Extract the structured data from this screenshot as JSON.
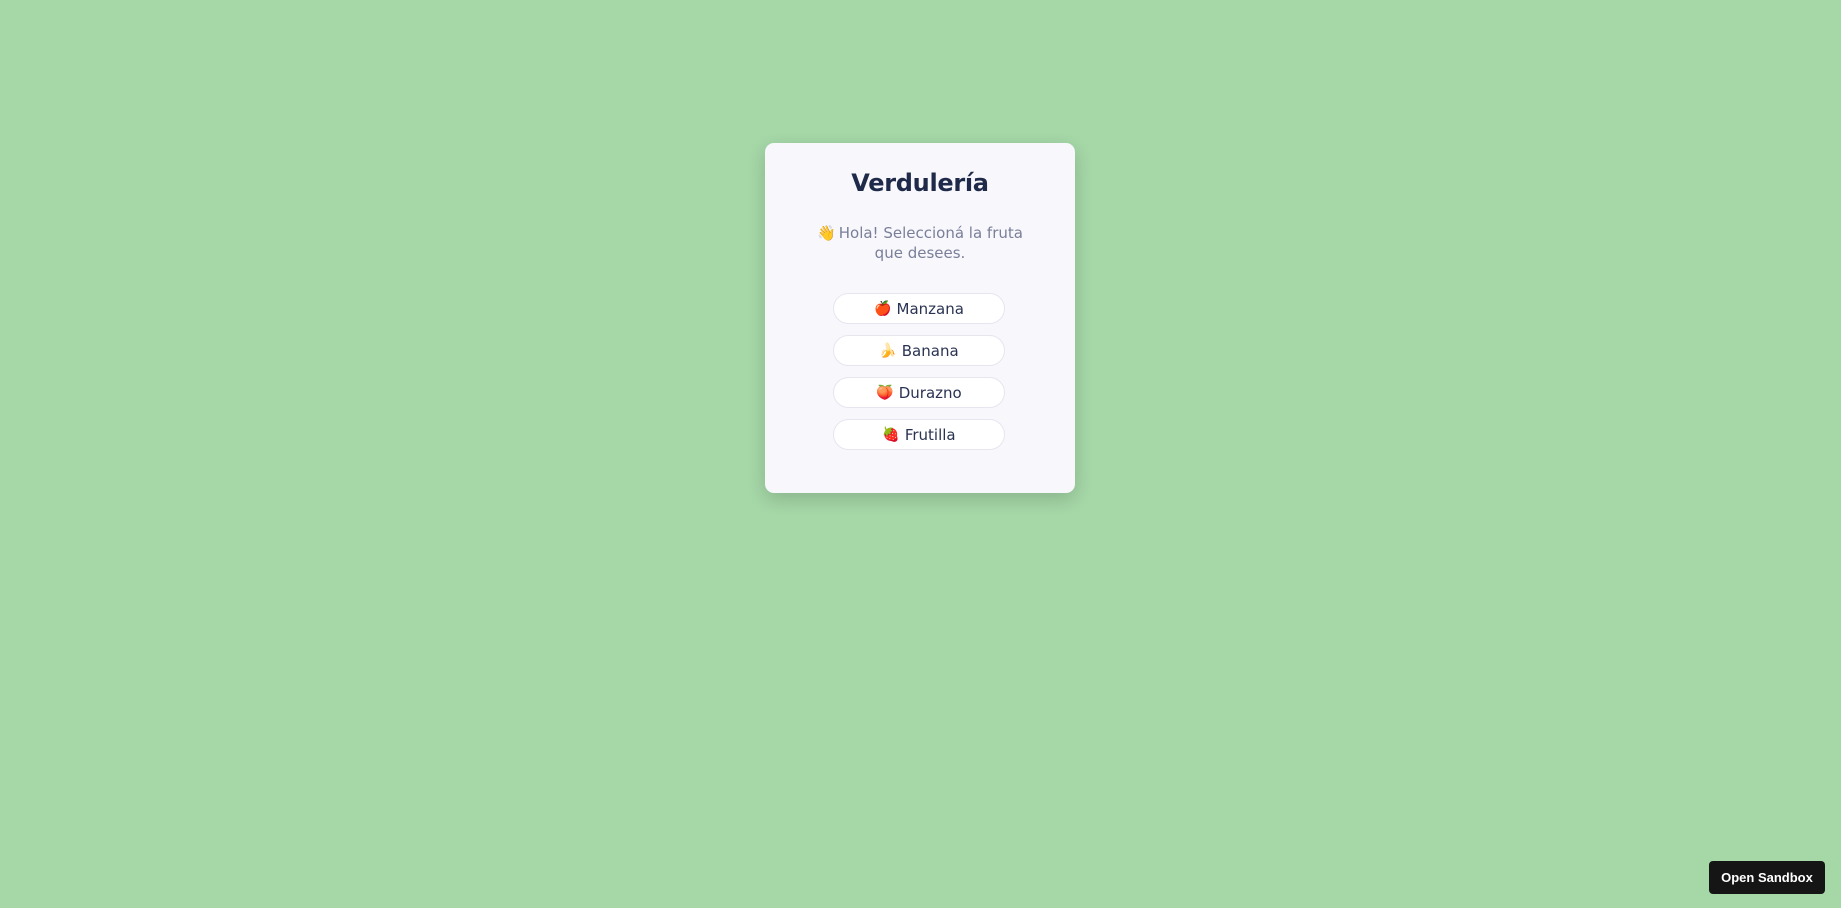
{
  "app": {
    "title": "Verdulería",
    "greeting_icon": "👋",
    "greeting": "Hola! Seleccioná la fruta que desees."
  },
  "options": [
    {
      "icon": "🍎",
      "icon_name": "apple-icon",
      "label": "Manzana"
    },
    {
      "icon": "🍌",
      "icon_name": "banana-icon",
      "label": "Banana"
    },
    {
      "icon": "🍑",
      "icon_name": "peach-icon",
      "label": "Durazno"
    },
    {
      "icon": "🍓",
      "icon_name": "strawberry-icon",
      "label": "Frutilla"
    }
  ],
  "sandbox": {
    "label": "Open Sandbox"
  },
  "colors": {
    "background": "#a5d7a7",
    "card": "#f7f7fc",
    "title": "#1f2a4a",
    "subtitle": "#7a7f99",
    "sandbox_button": "#151515"
  }
}
